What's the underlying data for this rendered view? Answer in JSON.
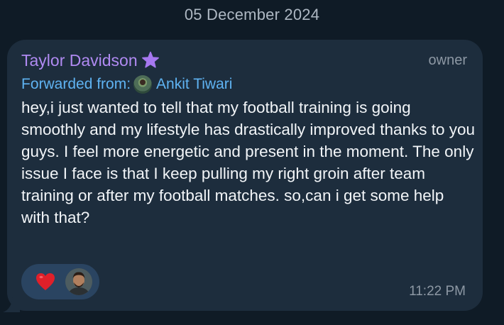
{
  "date_separator": "05 December 2024",
  "message": {
    "sender_name": "Taylor Davidson",
    "sender_badge_icon": "star-icon",
    "role": "owner",
    "forwarded_label": "Forwarded from:",
    "forwarded_name": "Ankit Tiwari",
    "text": "hey,i just wanted to tell that my football training is going smoothly and my lifestyle has drastically improved thanks to you guys. I feel more energetic and present in the moment. The only issue I face is that I keep pulling my right groin after team training or after my football matches. so,can i get some help with that?",
    "time": "11:22 PM",
    "reactions": [
      {
        "icon": "heart-icon",
        "color": "#e0202a"
      }
    ]
  },
  "colors": {
    "background": "#0f1b26",
    "bubble": "#1d2d3d",
    "sender_name": "#b08af2",
    "link": "#5fb3f2",
    "reaction_bg": "#2a4461"
  }
}
